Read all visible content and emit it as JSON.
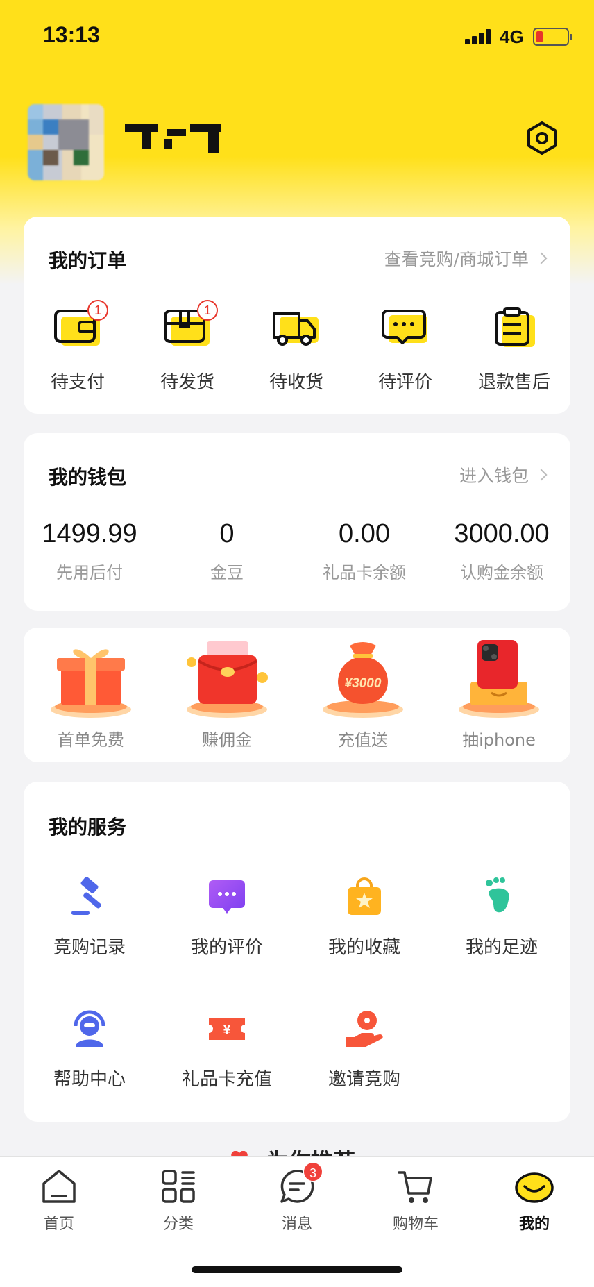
{
  "status": {
    "time": "13:13",
    "network": "4G"
  },
  "colors": {
    "brand_yellow": "#ffe01a",
    "badge_red": "#e8352b"
  },
  "orders": {
    "title": "我的订单",
    "link": "查看竞购/商城订单",
    "items": [
      {
        "label": "待支付",
        "badge": "1",
        "icon": "wallet-icon"
      },
      {
        "label": "待发货",
        "badge": "1",
        "icon": "package-icon"
      },
      {
        "label": "待收货",
        "icon": "truck-icon"
      },
      {
        "label": "待评价",
        "icon": "comment-icon"
      },
      {
        "label": "退款售后",
        "icon": "clipboard-icon"
      }
    ]
  },
  "wallet": {
    "title": "我的钱包",
    "link": "进入钱包",
    "items": [
      {
        "value": "1499.99",
        "label": "先用后付"
      },
      {
        "value": "0",
        "label": "金豆"
      },
      {
        "value": "0.00",
        "label": "礼品卡余额"
      },
      {
        "value": "3000.00",
        "label": "认购金余额"
      }
    ]
  },
  "promos": {
    "items": [
      {
        "label": "首单免费",
        "icon": "gift-box-icon"
      },
      {
        "label": "赚佣金",
        "icon": "red-envelope-icon"
      },
      {
        "label": "充值送",
        "icon": "money-bag-icon",
        "art_text": "¥3000"
      },
      {
        "label": "抽iphone",
        "icon": "iphone-icon"
      }
    ]
  },
  "services": {
    "title": "我的服务",
    "items": [
      {
        "label": "竞购记录",
        "icon": "gavel-icon"
      },
      {
        "label": "我的评价",
        "icon": "chat-bubble-icon"
      },
      {
        "label": "我的收藏",
        "icon": "star-bag-icon"
      },
      {
        "label": "我的足迹",
        "icon": "footprint-icon"
      },
      {
        "label": "帮助中心",
        "icon": "support-agent-icon"
      },
      {
        "label": "礼品卡充值",
        "icon": "gift-card-icon"
      },
      {
        "label": "邀请竞购",
        "icon": "invite-hand-icon"
      }
    ]
  },
  "recommend_peek": "为你推荐",
  "tabs": [
    {
      "label": "首页",
      "icon": "home-icon"
    },
    {
      "label": "分类",
      "icon": "category-icon"
    },
    {
      "label": "消息",
      "icon": "message-icon",
      "badge": "3"
    },
    {
      "label": "购物车",
      "icon": "cart-icon"
    },
    {
      "label": "我的",
      "icon": "lemon-face-icon",
      "active": true
    }
  ]
}
